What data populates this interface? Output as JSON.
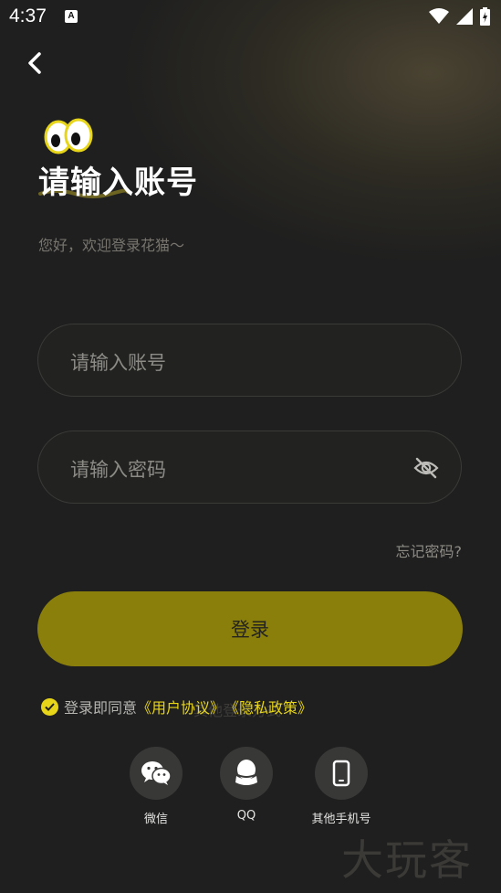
{
  "status_bar": {
    "time": "4:37",
    "a_badge": "A"
  },
  "header": {
    "back_icon": "chevron-left-icon"
  },
  "title": "请输入账号",
  "subtitle": "您好，欢迎登录花猫～",
  "form": {
    "account_placeholder": "请输入账号",
    "password_placeholder": "请输入密码",
    "forgot_label": "忘记密码?",
    "login_label": "登录"
  },
  "agreement": {
    "prefix": "登录即同意",
    "user_agreement": "《用户协议》",
    "privacy_policy": "《隐私政策》"
  },
  "other_login_title": "其他登录方式",
  "social": [
    {
      "label": "微信",
      "icon": "wechat-icon"
    },
    {
      "label": "QQ",
      "icon": "qq-icon"
    },
    {
      "label": "其他手机号",
      "icon": "phone-icon"
    }
  ],
  "watermark": "大玩客",
  "colors": {
    "accent": "#e7d51a",
    "button": "#8b7f0c",
    "background": "#1f1f1f"
  }
}
